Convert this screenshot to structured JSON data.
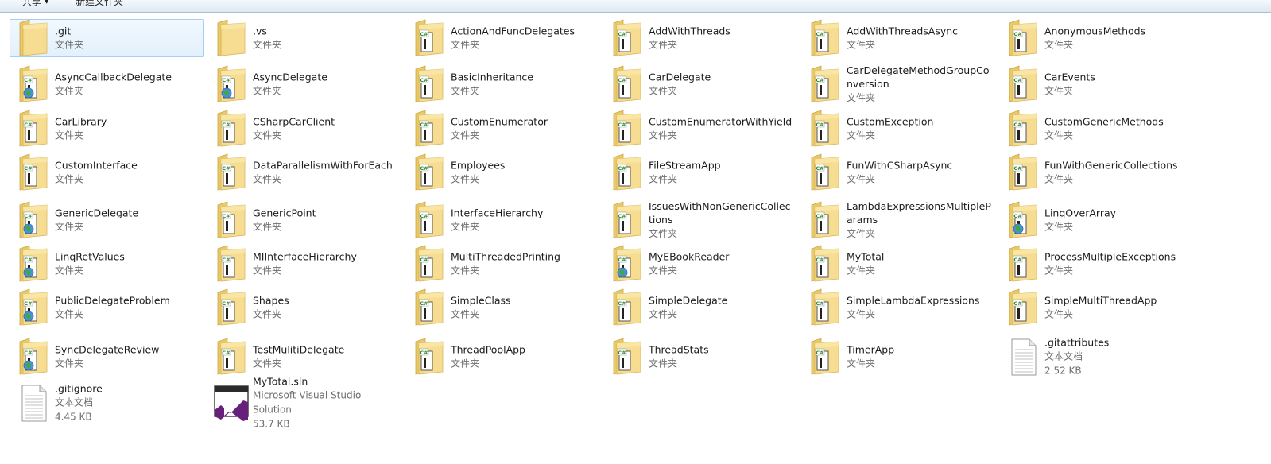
{
  "toolbar": {
    "share_label": "共享",
    "new_folder_label": "新建文件夹"
  },
  "items": [
    {
      "name": ".git",
      "type": "文件夹",
      "icon": "plain-folder-icon",
      "selected": true
    },
    {
      "name": ".vs",
      "type": "文件夹",
      "icon": "plain-folder-icon"
    },
    {
      "name": "ActionAndFuncDelegates",
      "type": "文件夹",
      "icon": "csharp-project-folder-icon"
    },
    {
      "name": "AddWithThreads",
      "type": "文件夹",
      "icon": "csharp-project-folder-icon"
    },
    {
      "name": "AddWithThreadsAsync",
      "type": "文件夹",
      "icon": "csharp-project-folder-icon"
    },
    {
      "name": "AnonymousMethods",
      "type": "文件夹",
      "icon": "csharp-project-folder-icon"
    },
    {
      "name": "AsyncCallbackDelegate",
      "type": "文件夹",
      "icon": "web-project-folder-icon"
    },
    {
      "name": "AsyncDelegate",
      "type": "文件夹",
      "icon": "web-project-folder-icon"
    },
    {
      "name": "BasicInheritance",
      "type": "文件夹",
      "icon": "csharp-project-folder-icon"
    },
    {
      "name": "CarDelegate",
      "type": "文件夹",
      "icon": "csharp-project-folder-icon"
    },
    {
      "name": "CarDelegateMethodGroupConversion",
      "type": "文件夹",
      "icon": "csharp-project-folder-icon"
    },
    {
      "name": "CarEvents",
      "type": "文件夹",
      "icon": "csharp-project-folder-icon"
    },
    {
      "name": "CarLibrary",
      "type": "文件夹",
      "icon": "csharp-project-folder-icon"
    },
    {
      "name": "CSharpCarClient",
      "type": "文件夹",
      "icon": "csharp-project-folder-icon"
    },
    {
      "name": "CustomEnumerator",
      "type": "文件夹",
      "icon": "csharp-project-folder-icon"
    },
    {
      "name": "CustomEnumeratorWithYield",
      "type": "文件夹",
      "icon": "csharp-project-folder-icon"
    },
    {
      "name": "CustomException",
      "type": "文件夹",
      "icon": "csharp-project-folder-icon"
    },
    {
      "name": "CustomGenericMethods",
      "type": "文件夹",
      "icon": "csharp-project-folder-icon"
    },
    {
      "name": "CustomInterface",
      "type": "文件夹",
      "icon": "csharp-project-folder-icon"
    },
    {
      "name": "DataParallelismWithForEach",
      "type": "文件夹",
      "icon": "csharp-project-folder-icon"
    },
    {
      "name": "Employees",
      "type": "文件夹",
      "icon": "csharp-project-folder-icon"
    },
    {
      "name": "FileStreamApp",
      "type": "文件夹",
      "icon": "csharp-project-folder-icon"
    },
    {
      "name": "FunWithCSharpAsync",
      "type": "文件夹",
      "icon": "csharp-project-folder-icon"
    },
    {
      "name": "FunWithGenericCollections",
      "type": "文件夹",
      "icon": "csharp-project-folder-icon"
    },
    {
      "name": "GenericDelegate",
      "type": "文件夹",
      "icon": "web-project-folder-icon"
    },
    {
      "name": "GenericPoint",
      "type": "文件夹",
      "icon": "csharp-project-folder-icon"
    },
    {
      "name": "InterfaceHierarchy",
      "type": "文件夹",
      "icon": "csharp-project-folder-icon"
    },
    {
      "name": "IssuesWithNonGenericCollections",
      "type": "文件夹",
      "icon": "csharp-project-folder-icon"
    },
    {
      "name": "LambdaExpressionsMultipleParams",
      "type": "文件夹",
      "icon": "csharp-project-folder-icon"
    },
    {
      "name": "LinqOverArray",
      "type": "文件夹",
      "icon": "web-project-folder-icon"
    },
    {
      "name": "LinqRetValues",
      "type": "文件夹",
      "icon": "web-project-folder-icon"
    },
    {
      "name": "MIInterfaceHierarchy",
      "type": "文件夹",
      "icon": "csharp-project-folder-icon"
    },
    {
      "name": "MultiThreadedPrinting",
      "type": "文件夹",
      "icon": "csharp-project-folder-icon"
    },
    {
      "name": "MyEBookReader",
      "type": "文件夹",
      "icon": "web-project-folder-icon"
    },
    {
      "name": "MyTotal",
      "type": "文件夹",
      "icon": "csharp-project-folder-icon"
    },
    {
      "name": "ProcessMultipleExceptions",
      "type": "文件夹",
      "icon": "csharp-project-folder-icon"
    },
    {
      "name": "PublicDelegateProblem",
      "type": "文件夹",
      "icon": "web-project-folder-icon"
    },
    {
      "name": "Shapes",
      "type": "文件夹",
      "icon": "csharp-project-folder-icon"
    },
    {
      "name": "SimpleClass",
      "type": "文件夹",
      "icon": "csharp-project-folder-icon"
    },
    {
      "name": "SimpleDelegate",
      "type": "文件夹",
      "icon": "csharp-project-folder-icon"
    },
    {
      "name": "SimpleLambdaExpressions",
      "type": "文件夹",
      "icon": "csharp-project-folder-icon"
    },
    {
      "name": "SimpleMultiThreadApp",
      "type": "文件夹",
      "icon": "csharp-project-folder-icon"
    },
    {
      "name": "SyncDelegateReview",
      "type": "文件夹",
      "icon": "web-project-folder-icon"
    },
    {
      "name": "TestMulitiDelegate",
      "type": "文件夹",
      "icon": "csharp-project-folder-icon"
    },
    {
      "name": "ThreadPoolApp",
      "type": "文件夹",
      "icon": "csharp-project-folder-icon"
    },
    {
      "name": "ThreadStats",
      "type": "文件夹",
      "icon": "csharp-project-folder-icon"
    },
    {
      "name": "TimerApp",
      "type": "文件夹",
      "icon": "csharp-project-folder-icon"
    },
    {
      "name": ".gitattributes",
      "type": "文本文档",
      "size": "2.52 KB",
      "icon": "text-document-icon"
    },
    {
      "name": ".gitignore",
      "type": "文本文档",
      "size": "4.45 KB",
      "icon": "text-document-icon"
    },
    {
      "name": "MyTotal.sln",
      "type": "Microsoft Visual Studio Solution",
      "size": "53.7 KB",
      "icon": "visual-studio-solution-icon"
    }
  ]
}
